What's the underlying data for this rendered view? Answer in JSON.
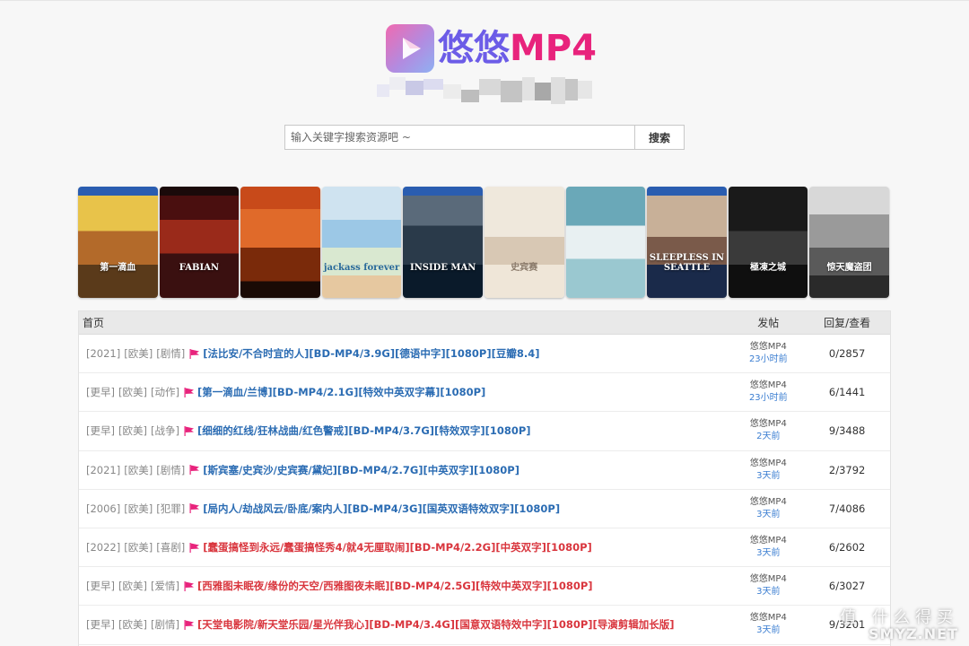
{
  "brand": {
    "name_cn": "悠悠",
    "name_en": "MP4",
    "colors": {
      "purple": "#6c5ce7",
      "pink": "#e8237c"
    }
  },
  "search": {
    "placeholder": "输入关键字搜索资源吧 ~",
    "button_label": "搜索"
  },
  "posters": [
    {
      "caption": "第一滴血"
    },
    {
      "caption": "FABIAN"
    },
    {
      "caption": ""
    },
    {
      "caption": "jackass forever"
    },
    {
      "caption": "INSIDE MAN"
    },
    {
      "caption": "史宾赛"
    },
    {
      "caption": ""
    },
    {
      "caption": "SLEEPLESS IN SEATTLE"
    },
    {
      "caption": "極凍之城"
    },
    {
      "caption": "惊天魔盗团"
    }
  ],
  "board": {
    "headers": {
      "home": "首页",
      "poster": "发帖",
      "stats": "回复/查看"
    },
    "rows": [
      {
        "year": "[2021]",
        "region": "[欧美]",
        "genre": "[剧情]",
        "title": "[法比安/不合时宜的人][BD-MP4/3.9G][德语中字][1080P][豆瓣8.4]",
        "color": "blue",
        "user": "悠悠MP4",
        "time": "23小时前",
        "stats": "0/2857"
      },
      {
        "year": "[更早]",
        "region": "[欧美]",
        "genre": "[动作]",
        "title": "[第一滴血/兰博][BD-MP4/2.1G][特效中英双字幕][1080P]",
        "color": "blue",
        "user": "悠悠MP4",
        "time": "23小时前",
        "stats": "6/1441"
      },
      {
        "year": "[更早]",
        "region": "[欧美]",
        "genre": "[战争]",
        "title": "[细细的红线/狂林战曲/红色警戒][BD-MP4/3.7G][特效双字][1080P]",
        "color": "blue",
        "user": "悠悠MP4",
        "time": "2天前",
        "stats": "9/3488"
      },
      {
        "year": "[2021]",
        "region": "[欧美]",
        "genre": "[剧情]",
        "title": "[斯宾塞/史宾沙/史宾赛/黛妃][BD-MP4/2.7G][中英双字][1080P]",
        "color": "blue",
        "user": "悠悠MP4",
        "time": "3天前",
        "stats": "2/3792"
      },
      {
        "year": "[2006]",
        "region": "[欧美]",
        "genre": "[犯罪]",
        "title": "[局内人/劫战风云/卧底/案内人][BD-MP4/3G][国英双语特效双字][1080P]",
        "color": "blue",
        "user": "悠悠MP4",
        "time": "3天前",
        "stats": "7/4086"
      },
      {
        "year": "[2022]",
        "region": "[欧美]",
        "genre": "[喜剧]",
        "title": "[蠢蛋搞怪到永远/蠢蛋搞怪秀4/就4无厘取闹][BD-MP4/2.2G][中英双字][1080P]",
        "color": "red",
        "user": "悠悠MP4",
        "time": "3天前",
        "stats": "6/2602"
      },
      {
        "year": "[更早]",
        "region": "[欧美]",
        "genre": "[爱情]",
        "title": "[西雅图未眠夜/缘份的天空/西雅图夜未眠][BD-MP4/2.5G][特效中英双字][1080P]",
        "color": "red",
        "user": "悠悠MP4",
        "time": "3天前",
        "stats": "6/3027"
      },
      {
        "year": "[更早]",
        "region": "[欧美]",
        "genre": "[剧情]",
        "title": "[天堂电影院/新天堂乐园/星光伴我心][BD-MP4/3.4G][国意双语特效中字][1080P][导演剪辑加长版]",
        "color": "red",
        "user": "悠悠MP4",
        "time": "3天前",
        "stats": "9/3201"
      }
    ]
  },
  "watermark": {
    "line1": "值 什么得买",
    "line2": "SMYZ.NET"
  },
  "flag_color": "#e8237c"
}
